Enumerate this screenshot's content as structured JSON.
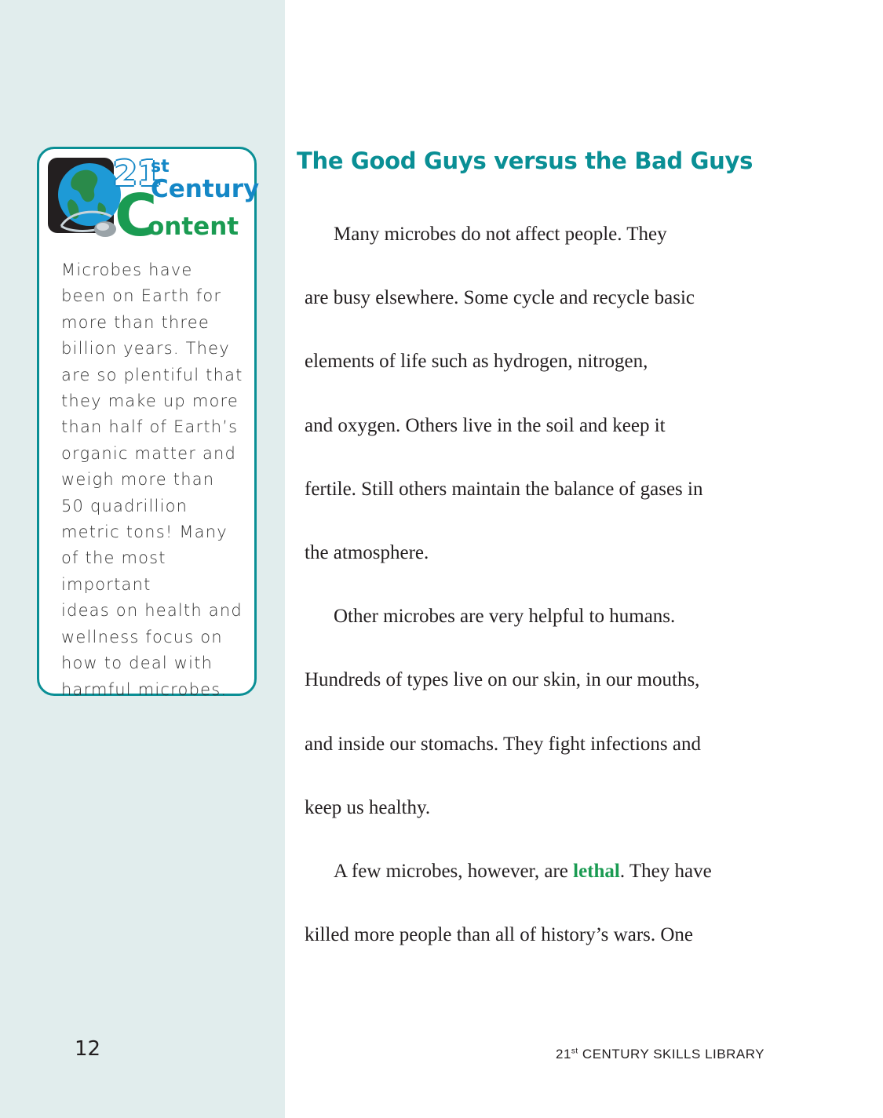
{
  "sidebar_box": {
    "logo": {
      "num": "21",
      "sup": "st",
      "line1": "Century",
      "big_letter": "C",
      "line2": "ontent"
    },
    "text_lines": [
      "Microbes have",
      "been on Earth for",
      "more than three",
      "billion years. They",
      "are so plentiful that",
      "they make up more",
      "than half of Earth’s",
      "organic matter and",
      "weigh more than",
      "50 quadrillion",
      "metric tons! Many",
      "of the most important",
      "ideas on health and",
      "wellness focus on",
      "how to deal with",
      "harmful microbes."
    ]
  },
  "main": {
    "heading": "The Good Guys versus the Bad Guys",
    "lines": [
      "Many microbes do not affect people. They",
      "are busy elsewhere. Some cycle and recycle basic",
      "elements of life such as hydrogen, nitrogen,",
      "and oxygen. Others live in the soil and keep it",
      "fertile. Still others maintain the balance of gases in",
      "the atmosphere.",
      "Other microbes are very helpful to humans.",
      "Hundreds of types live on our skin, in our mouths,",
      "and inside our stomachs. They fight infections and",
      "keep us healthy."
    ],
    "p3_start": "A few microbes, however, are ",
    "p3_vocab": "lethal",
    "p3_end": ". They have",
    "last_line": "killed more people than all of history’s wars. One"
  },
  "footer": {
    "page_number": "12",
    "series_num": "21",
    "series_sup": "st",
    "series_rest": " CENTURY SKILLS LIBRARY"
  }
}
